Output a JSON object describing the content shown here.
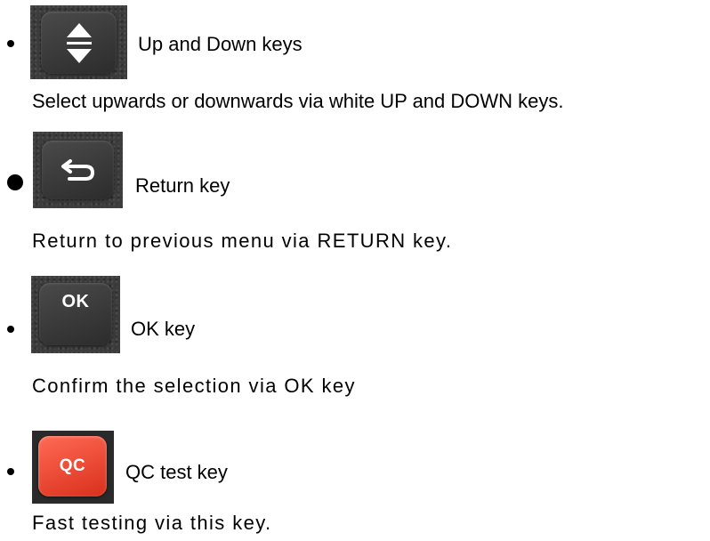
{
  "items": [
    {
      "icon": "up-down-arrows-icon",
      "key_label": "",
      "title": "Up and Down keys",
      "description": "Select upwards or downwards via white UP and DOWN keys."
    },
    {
      "icon": "return-arrow-icon",
      "key_label": "",
      "title": "Return key",
      "description": "Return to previous menu via RETURN key."
    },
    {
      "icon": "ok-key-icon",
      "key_label": "OK",
      "title": "OK key",
      "description": "Confirm the selection via OK key"
    },
    {
      "icon": "qc-key-icon",
      "key_label": "QC",
      "title": "QC test key",
      "description": "Fast testing via this key."
    }
  ],
  "colors": {
    "key_dark": "#3c3c3c",
    "key_red": "#e8412c",
    "text": "#000000"
  }
}
